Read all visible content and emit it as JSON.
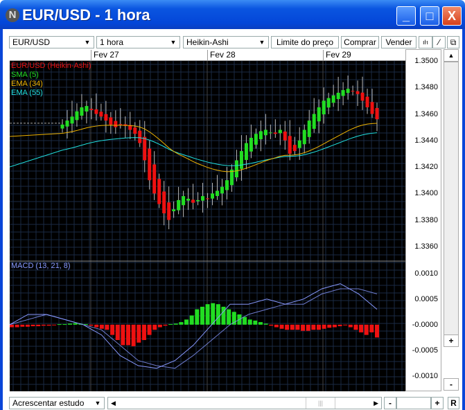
{
  "window": {
    "title": "EUR/USD - 1 hora",
    "minimize": "_",
    "maximize": "□",
    "close": "X"
  },
  "toolbar": {
    "symbol": "EUR/USD",
    "interval": "1 hora",
    "chart_type": "Heikin-Ashi",
    "limit_label": "Limite do preço",
    "buy_label": "Comprar",
    "sell_label": "Vender",
    "bars_icon": "ıŀı",
    "line_icon": "⁄",
    "detach_icon": "⧉"
  },
  "dates": [
    "Fev 27",
    "Fev 28",
    "Fev 29"
  ],
  "legend": {
    "main": "EUR/USD (Heikin-Ashi)",
    "sma": "SMA (5)",
    "ema34": "EMA (34)",
    "ema55": "EMA (55)",
    "macd": "MACD (13, 21, 8)"
  },
  "colors": {
    "up": "#22dd22",
    "down": "#ee1111",
    "sma": "#22dd22",
    "ema34": "#f0b400",
    "ema55": "#20e0e0",
    "macd": "#8899ff"
  },
  "price_axis": [
    "1.3500",
    "1.3480",
    "1.3460",
    "1.3440",
    "1.3420",
    "1.3400",
    "1.3380",
    "1.3360"
  ],
  "macd_axis": [
    "0.0010",
    "0.0005",
    "-0.0000",
    "-0.0005",
    "-0.0010"
  ],
  "bottom": {
    "study": "Acrescentar estudo",
    "zoom_out": "-",
    "zoom_in": "+",
    "reset": "R",
    "scroll_up": "▲",
    "plus": "+",
    "minus": "-"
  },
  "chart_data": {
    "type": "candlestick",
    "ylim": [
      1.335,
      1.35
    ],
    "closes": [
      1.3452,
      1.3455,
      1.3458,
      1.3462,
      1.3465,
      1.3466,
      1.3463,
      1.346,
      1.3458,
      1.3455,
      1.3452,
      1.345,
      1.3452,
      1.3451,
      1.3448,
      1.3445,
      1.3438,
      1.3425,
      1.341,
      1.34,
      1.3392,
      1.3385,
      1.338,
      1.3388,
      1.3395,
      1.3398,
      1.3396,
      1.3393,
      1.3395,
      1.3398,
      1.3396,
      1.34,
      1.3402,
      1.3405,
      1.341,
      1.3418,
      1.3425,
      1.3432,
      1.3438,
      1.3442,
      1.3445,
      1.3447,
      1.3448,
      1.3446,
      1.3445,
      1.3448,
      1.344,
      1.343,
      1.3432,
      1.344,
      1.3448,
      1.3455,
      1.346,
      1.3465,
      1.347,
      1.3472,
      1.3474,
      1.3476,
      1.3478,
      1.3479,
      1.3477,
      1.3475,
      1.347,
      1.3465,
      1.346,
      1.3456
    ],
    "macd_hist": [
      -5e-05,
      -5e-05,
      -4e-05,
      -4e-05,
      -3e-05,
      -3e-05,
      -2e-05,
      -2e-05,
      -1e-05,
      1e-05,
      1e-05,
      2e-05,
      3e-05,
      2e-05,
      1e-05,
      -2e-05,
      -5e-05,
      -8e-05,
      -0.0001,
      -0.0002,
      -0.0003,
      -0.0004,
      -0.0004,
      -0.00042,
      -0.00035,
      -0.0003,
      -0.0002,
      -0.0001,
      -5e-05,
      -2e-05,
      1e-05,
      2e-05,
      5e-05,
      0.0001,
      0.00018,
      0.0003,
      0.00035,
      0.0004,
      0.00042,
      0.0004,
      0.00035,
      0.0003,
      0.00025,
      0.0002,
      0.00015,
      0.0001,
      8e-05,
      5e-05,
      2e-05,
      -2e-05,
      -5e-05,
      -8e-05,
      -0.0001,
      -0.0001,
      -0.0001,
      -0.00012,
      -0.00012,
      -0.0001,
      -0.0001,
      -8e-05,
      -6e-05,
      -5e-05,
      -3e-05,
      -1e-05,
      -5e-05,
      -0.0001,
      -0.00015,
      -0.0002,
      -0.00015,
      -0.00025
    ],
    "macd": [
      0.0,
      0.0002,
      0.0002,
      0.0001,
      0.0,
      -0.0002,
      -0.0006,
      -0.0008,
      -0.00085,
      -0.0007,
      -0.0004,
      0.0,
      0.0004,
      0.0004,
      0.0005,
      0.0004,
      0.0005,
      0.0007,
      0.0008,
      0.0006,
      0.0003
    ],
    "signal": [
      0.0,
      0.0001,
      0.0002,
      0.0001,
      0.0,
      -0.0001,
      -0.0004,
      -0.0007,
      -0.0008,
      -0.00085,
      -0.0006,
      -0.0003,
      0.0,
      0.0002,
      0.0003,
      0.0004,
      0.0004,
      0.0006,
      0.0007,
      0.0007,
      0.0006
    ],
    "macd_ylim": [
      -0.0013,
      0.0012
    ]
  }
}
